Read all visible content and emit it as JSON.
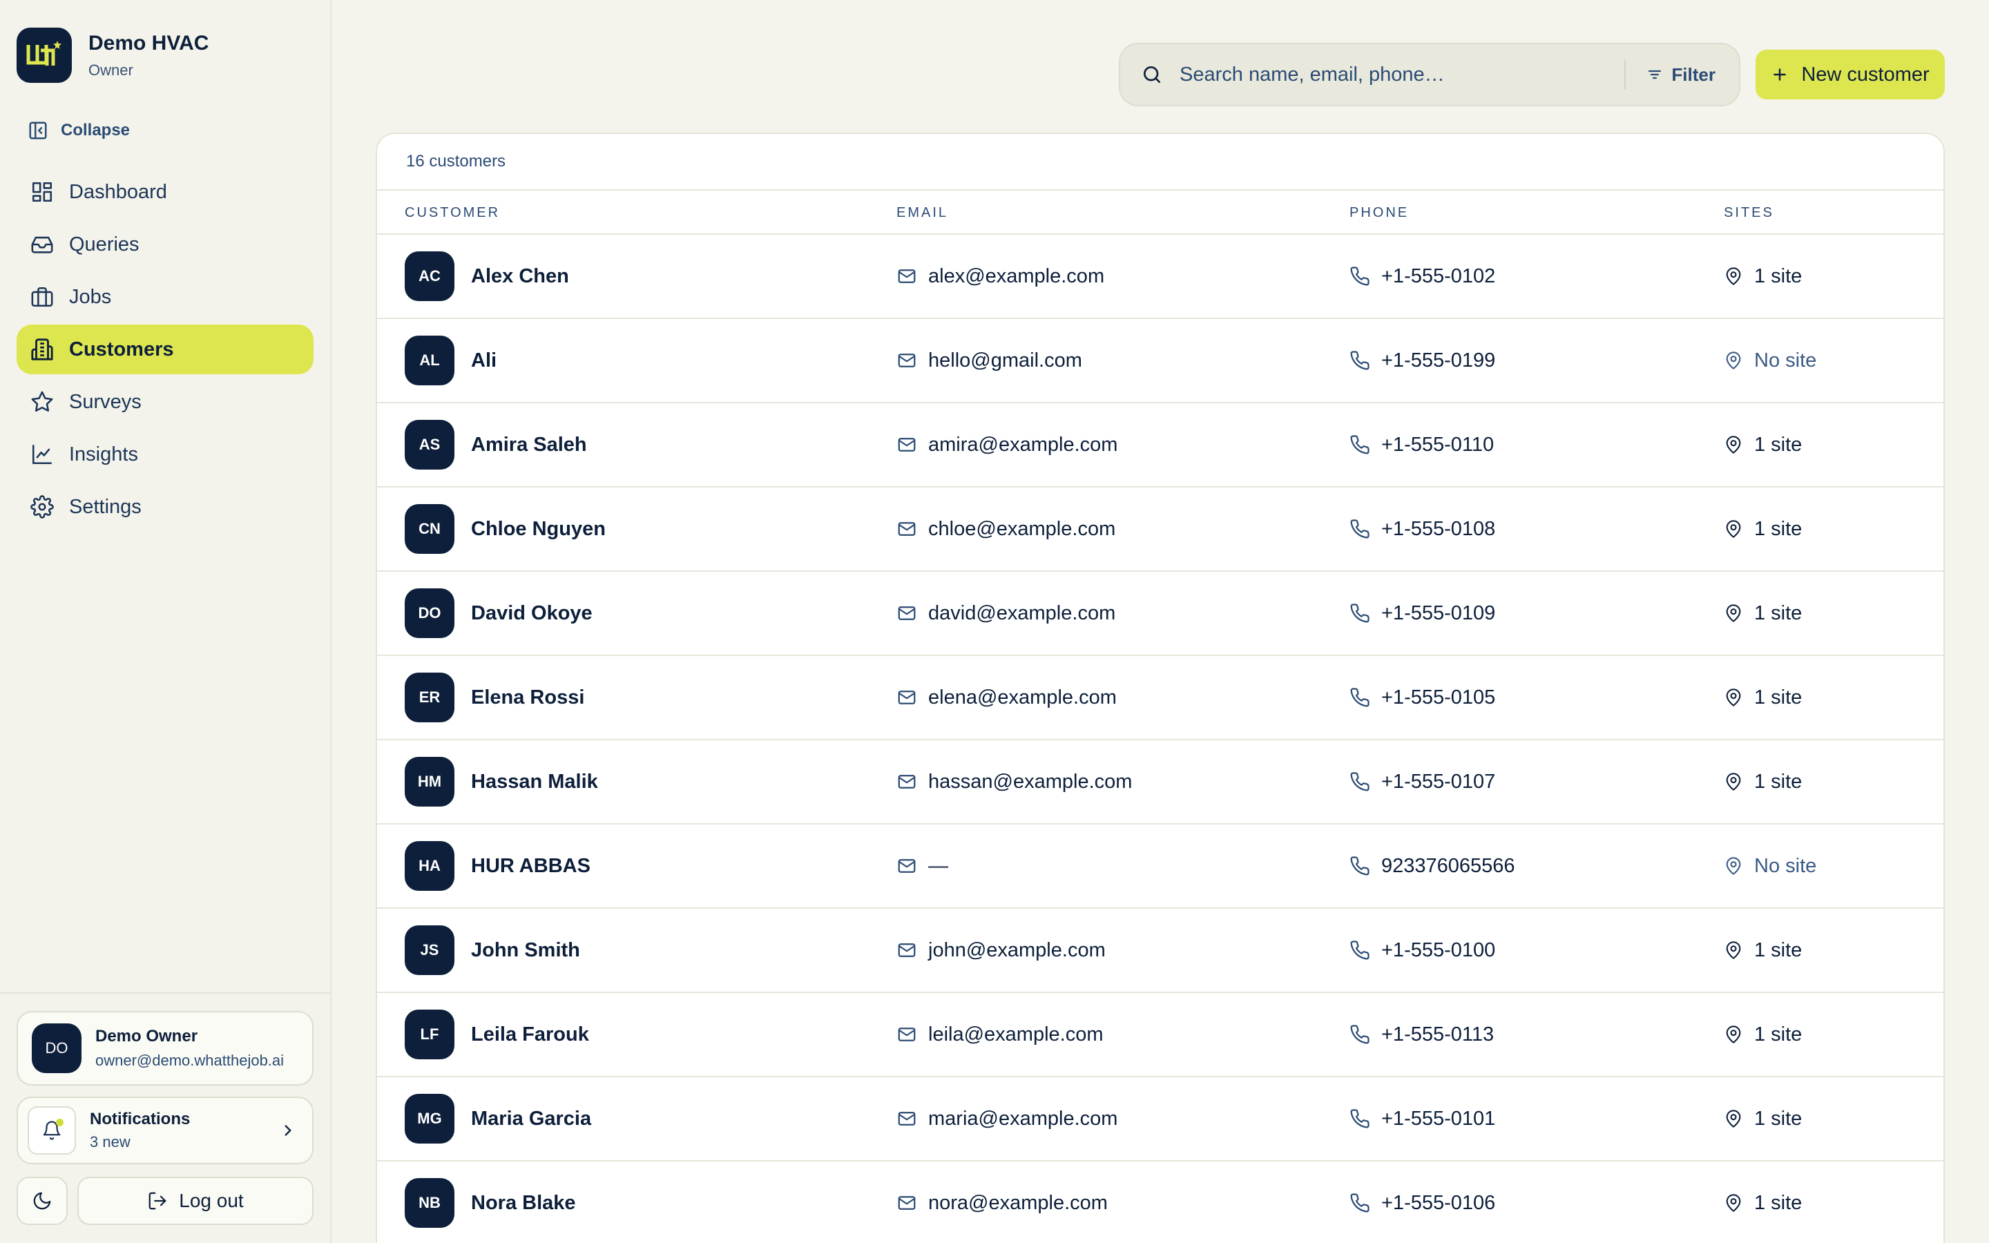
{
  "brand": {
    "name": "Demo HVAC",
    "role": "Owner"
  },
  "sidebar": {
    "collapse_label": "Collapse",
    "items": [
      {
        "label": "Dashboard",
        "icon": "dashboard-icon"
      },
      {
        "label": "Queries",
        "icon": "inbox-icon"
      },
      {
        "label": "Jobs",
        "icon": "briefcase-icon"
      },
      {
        "label": "Customers",
        "icon": "building-icon",
        "active": true
      },
      {
        "label": "Surveys",
        "icon": "star-icon"
      },
      {
        "label": "Insights",
        "icon": "line-chart-icon"
      },
      {
        "label": "Settings",
        "icon": "gear-icon"
      }
    ]
  },
  "user": {
    "initials": "DO",
    "name": "Demo Owner",
    "email": "owner@demo.whatthejob.ai"
  },
  "notifications": {
    "title": "Notifications",
    "subtitle": "3 new"
  },
  "logout_label": "Log out",
  "search": {
    "placeholder": "Search name, email, phone…",
    "value": ""
  },
  "filter_label": "Filter",
  "new_customer_label": "New customer",
  "table": {
    "count_label": "16 customers",
    "headers": {
      "customer": "CUSTOMER",
      "email": "EMAIL",
      "phone": "PHONE",
      "sites": "SITES"
    },
    "rows": [
      {
        "initials": "AC",
        "name": "Alex Chen",
        "email": "alex@example.com",
        "phone": "+1-555-0102",
        "sites": "1 site"
      },
      {
        "initials": "AL",
        "name": "Ali",
        "email": "hello@gmail.com",
        "phone": "+1-555-0199",
        "sites": "No site"
      },
      {
        "initials": "AS",
        "name": "Amira Saleh",
        "email": "amira@example.com",
        "phone": "+1-555-0110",
        "sites": "1 site"
      },
      {
        "initials": "CN",
        "name": "Chloe Nguyen",
        "email": "chloe@example.com",
        "phone": "+1-555-0108",
        "sites": "1 site"
      },
      {
        "initials": "DO",
        "name": "David Okoye",
        "email": "david@example.com",
        "phone": "+1-555-0109",
        "sites": "1 site"
      },
      {
        "initials": "ER",
        "name": "Elena Rossi",
        "email": "elena@example.com",
        "phone": "+1-555-0105",
        "sites": "1 site"
      },
      {
        "initials": "HM",
        "name": "Hassan Malik",
        "email": "hassan@example.com",
        "phone": "+1-555-0107",
        "sites": "1 site"
      },
      {
        "initials": "HA",
        "name": "HUR ABBAS",
        "email": "—",
        "phone": "923376065566",
        "sites": "No site"
      },
      {
        "initials": "JS",
        "name": "John Smith",
        "email": "john@example.com",
        "phone": "+1-555-0100",
        "sites": "1 site"
      },
      {
        "initials": "LF",
        "name": "Leila Farouk",
        "email": "leila@example.com",
        "phone": "+1-555-0113",
        "sites": "1 site"
      },
      {
        "initials": "MG",
        "name": "Maria Garcia",
        "email": "maria@example.com",
        "phone": "+1-555-0101",
        "sites": "1 site"
      },
      {
        "initials": "NB",
        "name": "Nora Blake",
        "email": "nora@example.com",
        "phone": "+1-555-0106",
        "sites": "1 site"
      }
    ]
  },
  "colors": {
    "accent": "#dde64f",
    "navy": "#0d1f3a",
    "muted": "#2b4b74",
    "background": "#f4f4ec"
  }
}
